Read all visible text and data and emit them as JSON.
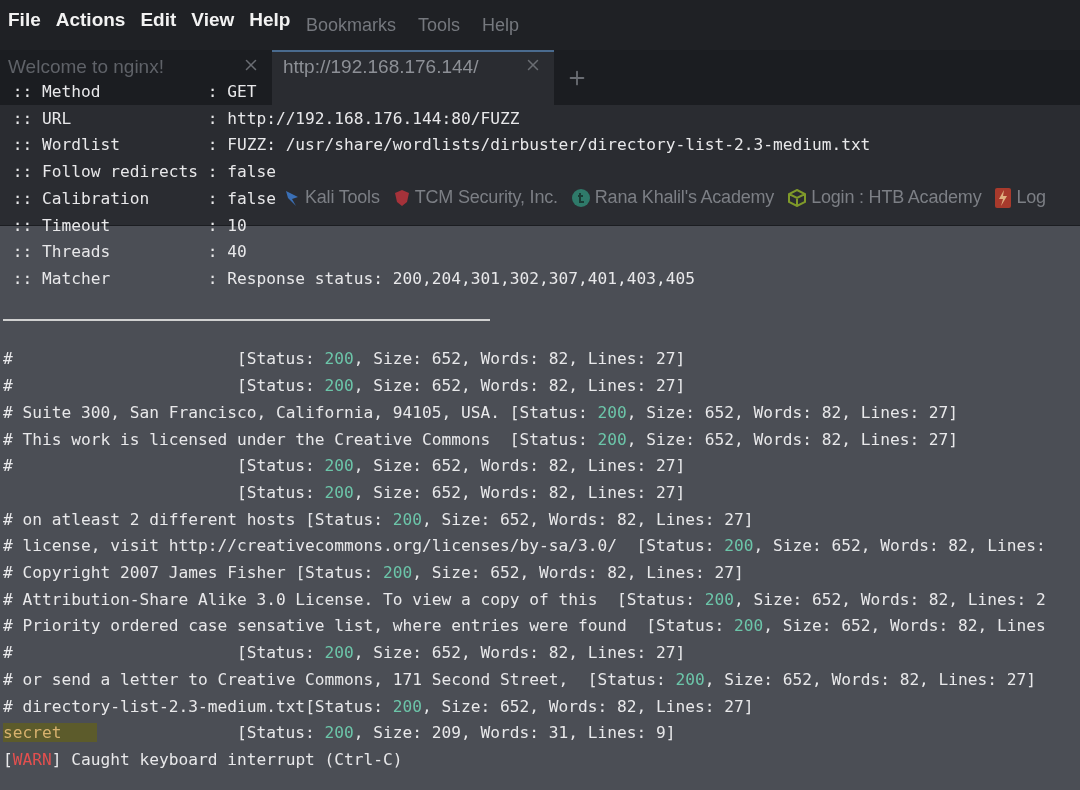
{
  "browser": {
    "menu": [
      "Bookmarks",
      "Tools",
      "Help"
    ],
    "tabs": [
      {
        "title": "Welcome to nginx!",
        "selected": false
      },
      {
        "title": "http://192.168.176.144/",
        "selected": true
      }
    ],
    "bookmarks": [
      {
        "kind": "kali",
        "label": "Kali Tools"
      },
      {
        "kind": "tcm",
        "label": "TCM Security, Inc."
      },
      {
        "kind": "rana",
        "label": "Rana Khalil's Academy"
      },
      {
        "kind": "htb",
        "label": "Login : HTB Academy"
      },
      {
        "kind": "bolt",
        "label": "Log"
      }
    ]
  },
  "terminal": {
    "menu": [
      "File",
      "Actions",
      "Edit",
      "View",
      "Help"
    ],
    "settings": [
      " :: Method           : GET",
      " :: URL              : http://192.168.176.144:80/FUZZ",
      " :: Wordlist         : FUZZ: /usr/share/wordlists/dirbuster/directory-list-2.3-medium.txt",
      " :: Follow redirects : false",
      " :: Calibration      : false",
      " :: Timeout          : 10",
      " :: Threads          : 40",
      " :: Matcher          : Response status: 200,204,301,302,307,401,403,405"
    ],
    "results": [
      {
        "word": "#",
        "status_label": "[Status: ",
        "code": "200",
        "details": ", Size: 652, Words: 82, Lines: 27]"
      },
      {
        "word": "#",
        "status_label": "[Status: ",
        "code": "200",
        "details": ", Size: 652, Words: 82, Lines: 27]"
      },
      {
        "word": "# Suite 300, San Francisco, California, 94105, USA. ",
        "status_label": "[Status: ",
        "code": "200",
        "details": ", Size: 652, Words: 82, Lines: 27]"
      },
      {
        "word": "# This work is licensed under the Creative Commons  ",
        "status_label": "[Status: ",
        "code": "200",
        "details": ", Size: 652, Words: 82, Lines: 27]"
      },
      {
        "word": "#",
        "status_label": "[Status: ",
        "code": "200",
        "details": ", Size: 652, Words: 82, Lines: 27]"
      },
      {
        "status_label": "[Status: ",
        "code": "200",
        "details": ", Size: 652, Words: 82, Lines: 27]"
      },
      {
        "word": "# on atleast 2 different hosts ",
        "status_label": "[Status: ",
        "code": "200",
        "details": ", Size: 652, Words: 82, Lines: 27]"
      },
      {
        "word": "# license, visit http://creativecommons.org/licenses/by-sa/3.0/  ",
        "status_label": "[Status: ",
        "code": "200",
        "details": ", Size: 652, Words: 82, Lines:"
      },
      {
        "word": "# Copyright 2007 James Fisher ",
        "status_label": "[Status: ",
        "code": "200",
        "details": ", Size: 652, Words: 82, Lines: 27]"
      },
      {
        "word": "# Attribution-Share Alike 3.0 License. To view a copy of this  ",
        "status_label": "[Status: ",
        "code": "200",
        "details": ", Size: 652, Words: 82, Lines: 2"
      },
      {
        "word": "# Priority ordered case sensative list, where entries were found  ",
        "status_label": "[Status: ",
        "code": "200",
        "details": ", Size: 652, Words: 82, Lines"
      },
      {
        "word": "#",
        "status_label": "[Status: ",
        "code": "200",
        "details": ", Size: 652, Words: 82, Lines: 27]"
      },
      {
        "word": "# or send a letter to Creative Commons, 171 Second Street,  ",
        "status_label": "[Status: ",
        "code": "200",
        "details": ", Size: 652, Words: 82, Lines: 27]"
      },
      {
        "word": "# directory-list-2.3-medium.txt",
        "status_label": "[Status: ",
        "code": "200",
        "details": ", Size: 652, Words: 82, Lines: 27]"
      },
      {
        "word": "secret",
        "highlighted": true,
        "status_label": "[Status: ",
        "code": "200",
        "details": ", Size: 209, Words: 31, Lines: 9]"
      }
    ],
    "warning": {
      "open": "[",
      "tag": "WARN",
      "message": "] Caught keyboard interrupt (Ctrl-C)"
    }
  }
}
